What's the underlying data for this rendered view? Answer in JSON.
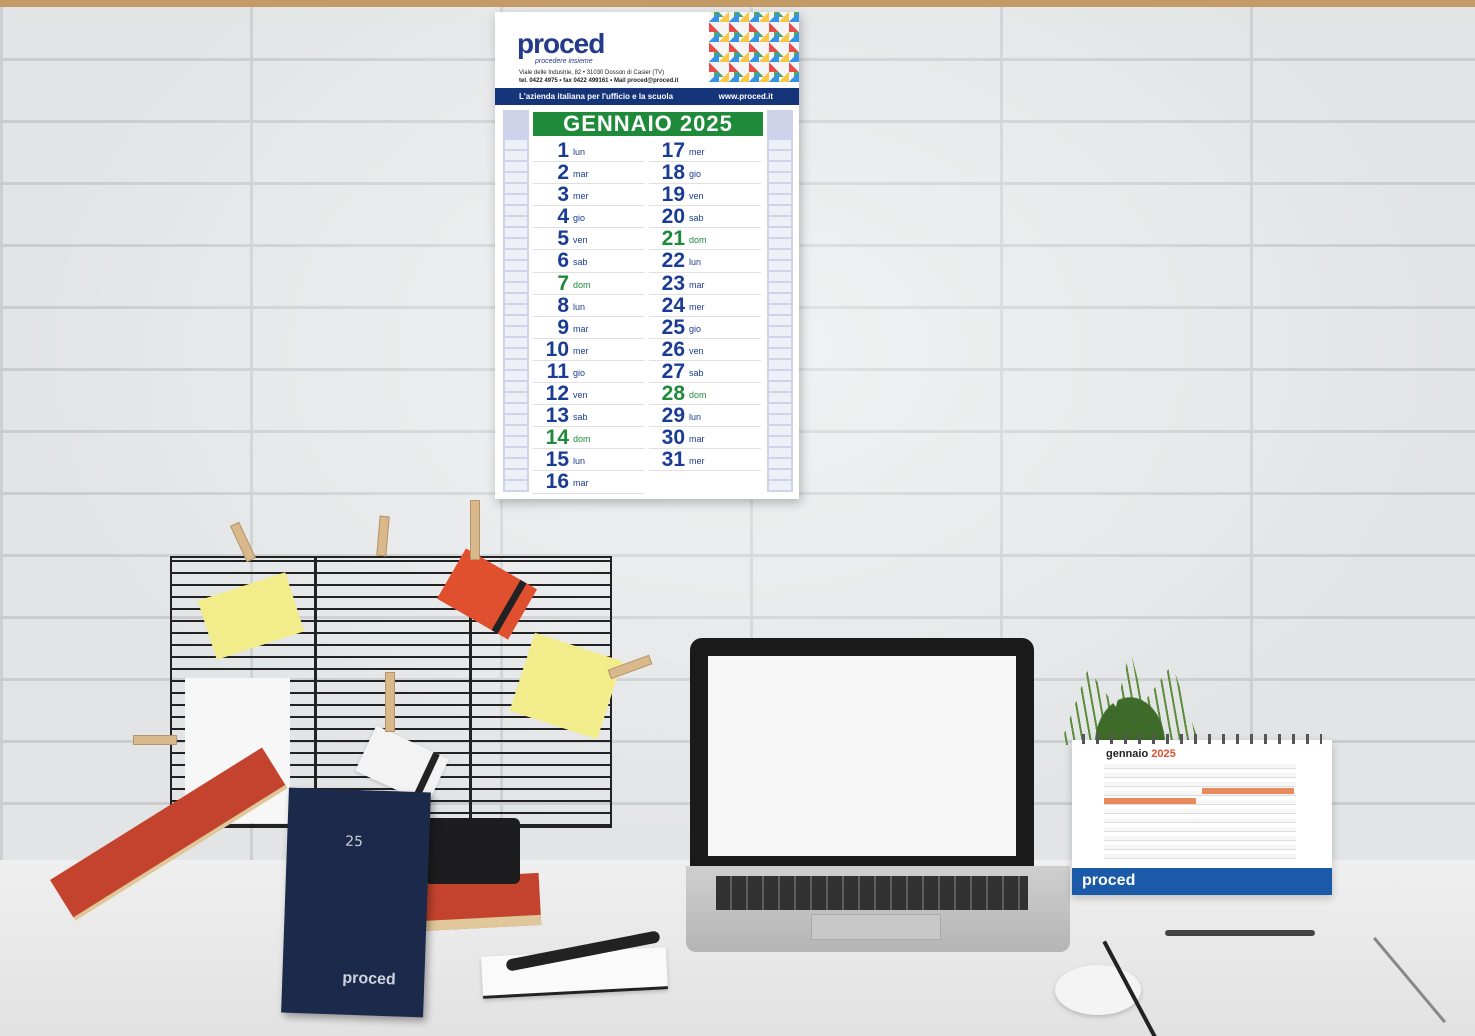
{
  "wall_calendar": {
    "logo": "proced",
    "tagline": "procedere insieme",
    "address": "Viale delle Industrie, 82 • 31030 Dosson di Casier (TV)",
    "contacts": "tel. 0422 4975 • fax 0422 499161 • Mail proced@proced.it",
    "banner_left": "L'azienda italiana per l'ufficio e la scuola",
    "banner_right": "www.proced.it",
    "month_title": "GENNAIO 2025",
    "days_col1": [
      {
        "num": "1",
        "name": "lun"
      },
      {
        "num": "2",
        "name": "mar"
      },
      {
        "num": "3",
        "name": "mer"
      },
      {
        "num": "4",
        "name": "gio"
      },
      {
        "num": "5",
        "name": "ven"
      },
      {
        "num": "6",
        "name": "sab"
      },
      {
        "num": "7",
        "name": "dom"
      },
      {
        "num": "8",
        "name": "lun"
      },
      {
        "num": "9",
        "name": "mar"
      },
      {
        "num": "10",
        "name": "mer"
      },
      {
        "num": "11",
        "name": "gio"
      },
      {
        "num": "12",
        "name": "ven"
      },
      {
        "num": "13",
        "name": "sab"
      },
      {
        "num": "14",
        "name": "dom"
      },
      {
        "num": "15",
        "name": "lun"
      },
      {
        "num": "16",
        "name": "mar"
      }
    ],
    "days_col2": [
      {
        "num": "17",
        "name": "mer"
      },
      {
        "num": "18",
        "name": "gio"
      },
      {
        "num": "19",
        "name": "ven"
      },
      {
        "num": "20",
        "name": "sab"
      },
      {
        "num": "21",
        "name": "dom"
      },
      {
        "num": "22",
        "name": "lun"
      },
      {
        "num": "23",
        "name": "mar"
      },
      {
        "num": "24",
        "name": "mer"
      },
      {
        "num": "25",
        "name": "gio"
      },
      {
        "num": "26",
        "name": "ven"
      },
      {
        "num": "27",
        "name": "sab"
      },
      {
        "num": "28",
        "name": "dom"
      },
      {
        "num": "29",
        "name": "lun"
      },
      {
        "num": "30",
        "name": "mar"
      },
      {
        "num": "31",
        "name": "mer"
      }
    ]
  },
  "planner": {
    "year": "25",
    "logo": "proced"
  },
  "desk_calendar": {
    "title": "gennaio",
    "year": "2025",
    "logo": "proced"
  },
  "colors": {
    "brand_blue": "#1a3c94",
    "sunday_green": "#1f8a3a",
    "accent_orange": "#e0502e"
  }
}
